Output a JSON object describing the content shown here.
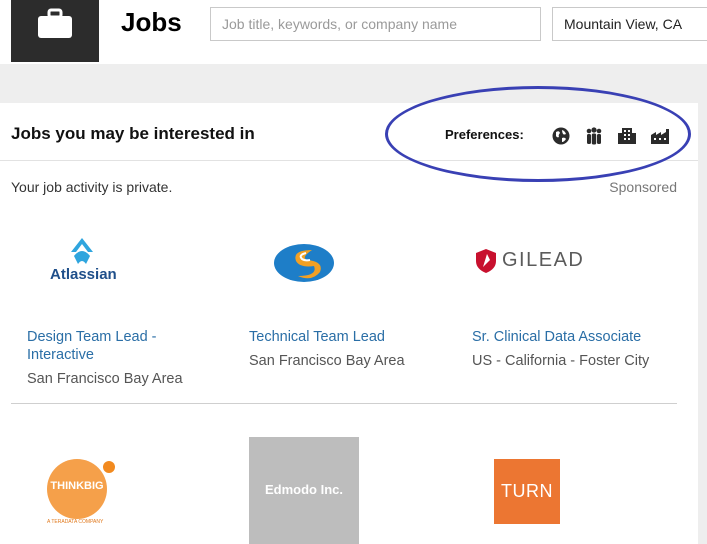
{
  "header": {
    "title": "Jobs",
    "search": {
      "placeholder": "Job title, keywords, or company name",
      "value": ""
    },
    "location": {
      "value": "Mountain View, CA"
    }
  },
  "card": {
    "title": "Jobs you may be interested in",
    "preferences_label": "Preferences:",
    "preference_icons": [
      "globe-icon",
      "people-icon",
      "building-icon",
      "factory-icon"
    ],
    "privacy_note": "Your job activity is private.",
    "sponsored_label": "Sponsored"
  },
  "jobs": [
    {
      "company_logo_text": "Atlassian",
      "title_line1": "Design Team Lead -",
      "title_line2": "Interactive",
      "location": "San Francisco Bay Area"
    },
    {
      "company_logo_text": "",
      "title": "Technical Team Lead",
      "location": "San Francisco Bay Area"
    },
    {
      "company_logo_text": "GILEAD",
      "title": "Sr. Clinical Data Associate",
      "location": "US - California - Foster City"
    }
  ],
  "more_companies": [
    {
      "logo_text": "THINKBIG",
      "logo_subtext": "A TERADATA COMPANY"
    },
    {
      "logo_text": "Edmodo Inc."
    },
    {
      "logo_text": "TURN"
    }
  ],
  "colors": {
    "link": "#2a6ea6",
    "brand_box": "#2c2c2c",
    "annotation": "#3940b4",
    "turn": "#ec7632",
    "thinkbig": "#f5a04a"
  }
}
